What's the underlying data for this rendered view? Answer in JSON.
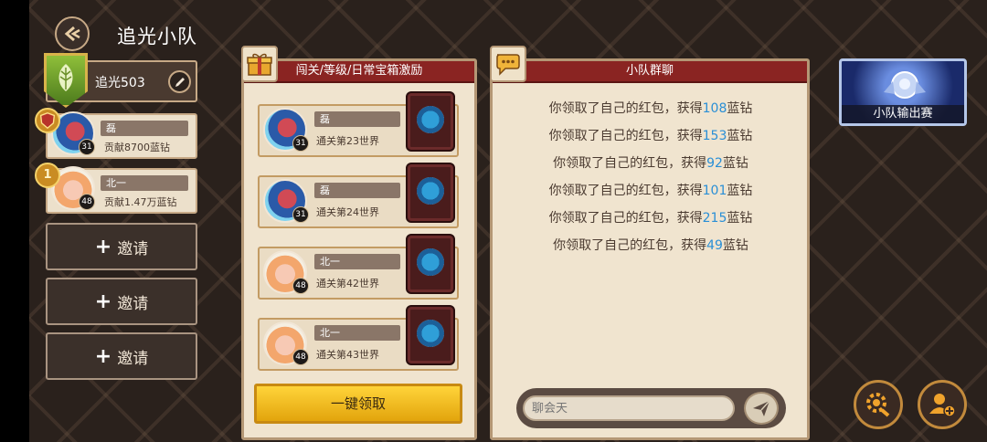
{
  "header": {
    "title": "追光小队"
  },
  "team": {
    "name": "追光503"
  },
  "members": [
    {
      "name": "磊",
      "contribution": "贡献8700蓝钻",
      "level": "31",
      "rank": ""
    },
    {
      "name": "北一",
      "contribution": "贡献1.47万蓝钻",
      "level": "48",
      "rank": "1"
    }
  ],
  "invite": {
    "label": "邀请"
  },
  "reward_panel": {
    "title": "闯关/等级/日常宝箱激励",
    "rows": [
      {
        "name": "磊",
        "desc": "通关第23世界",
        "level": "31"
      },
      {
        "name": "磊",
        "desc": "通关第24世界",
        "level": "31"
      },
      {
        "name": "北一",
        "desc": "通关第42世界",
        "level": "48"
      },
      {
        "name": "北一",
        "desc": "通关第43世界",
        "level": "48"
      }
    ],
    "claim_all": "一键领取"
  },
  "chat_panel": {
    "title": "小队群聊",
    "message_prefix": "你领取了自己的红包，获得",
    "message_suffix": "蓝钻",
    "amounts": [
      "108",
      "153",
      "92",
      "101",
      "215",
      "49"
    ],
    "input_placeholder": "聊会天"
  },
  "side": {
    "output_label": "小队输出赛"
  },
  "colors": {
    "accent_red": "#8a2422",
    "gold": "#e2a40c",
    "highlight_blue": "#2a8fd6"
  }
}
